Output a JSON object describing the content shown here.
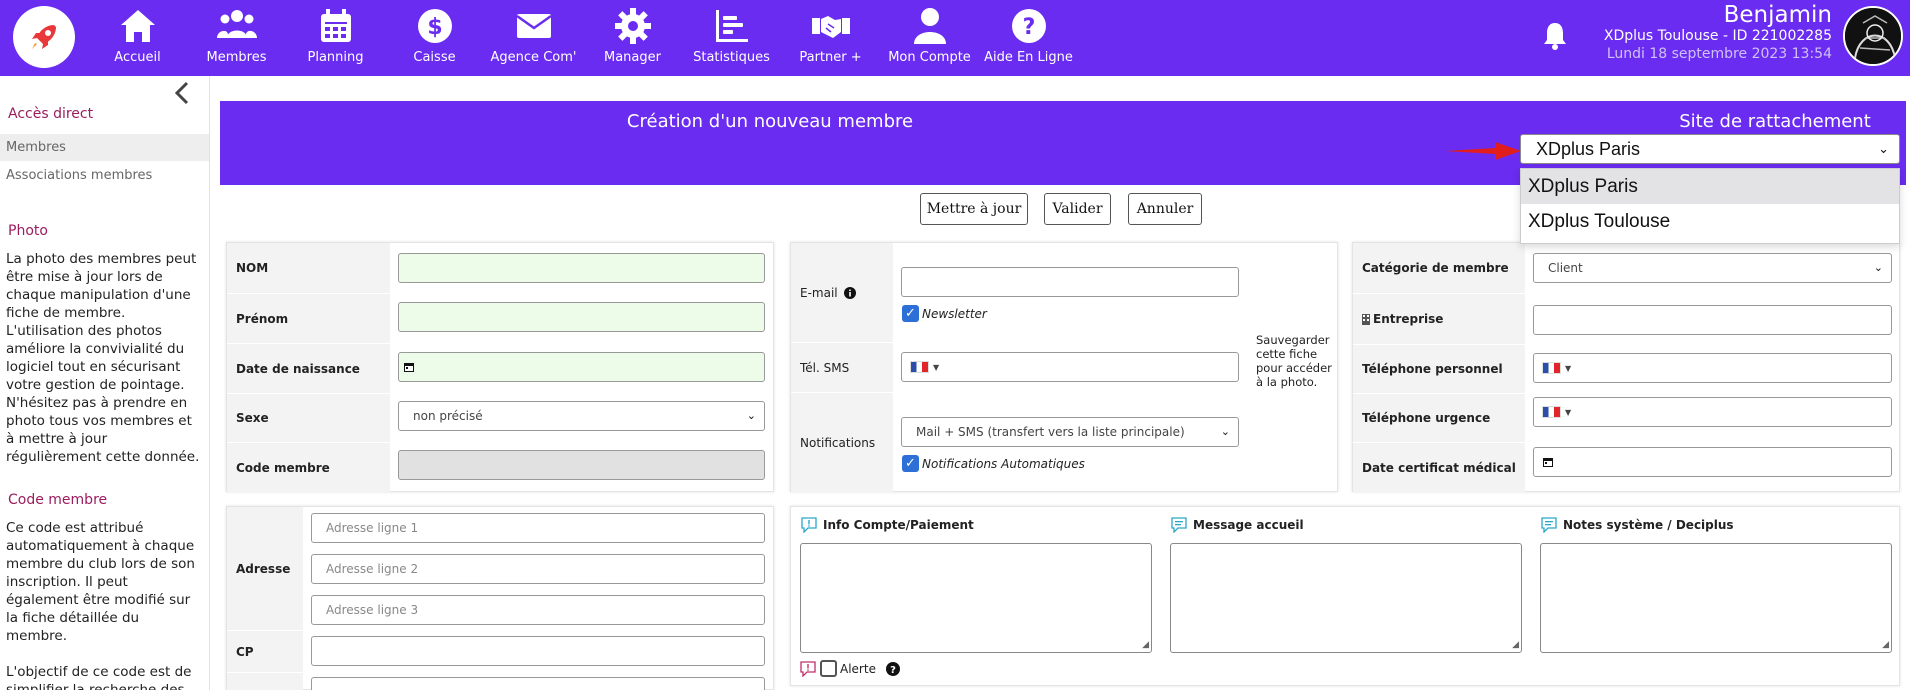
{
  "nav": {
    "items": [
      {
        "label": "Accueil",
        "icon": "home-icon"
      },
      {
        "label": "Membres",
        "icon": "users-icon"
      },
      {
        "label": "Planning",
        "icon": "calendar-icon"
      },
      {
        "label": "Caisse",
        "icon": "dollar-icon"
      },
      {
        "label": "Agence Com'",
        "icon": "mail-icon"
      },
      {
        "label": "Manager",
        "icon": "gear-icon"
      },
      {
        "label": "Statistiques",
        "icon": "chart-icon"
      },
      {
        "label": "Partner +",
        "icon": "handshake-icon"
      },
      {
        "label": "Mon Compte",
        "icon": "user-icon"
      },
      {
        "label": "Aide En Ligne",
        "icon": "help-icon"
      }
    ],
    "accent": "#6a2cf0"
  },
  "user": {
    "name": "Benjamin",
    "site": "XDplus Toulouse - ID 221002285",
    "date": "Lundi 18 septembre 2023 13:54"
  },
  "sidebar": {
    "section_title": "Accès direct",
    "links": [
      "Membres",
      "Associations membres"
    ],
    "photo_title": "Photo",
    "photo_text": "La photo des membres peut être mise à jour lors de chaque manipulation d'une fiche de membre. L'utilisation des photos améliore la convivialité du logiciel tout en sécurisant votre gestion de pointage. N'hésitez pas à prendre en photo tous vos membres et à mettre à jour régulièrement cette donnée.",
    "code_title": "Code membre",
    "code_text": "Ce code est attribué automatiquement à chaque membre du club lors de son inscription. Il peut également être modifié sur la fiche détaillée du membre.",
    "code_text2": "L'objectif de ce code est de simplifier la recherche des"
  },
  "header": {
    "title": "Création d'un nouveau membre",
    "site_title": "Site de rattachement",
    "site_selected": "XDplus Paris",
    "site_options": [
      "XDplus Paris",
      "XDplus Toulouse"
    ]
  },
  "actions": {
    "update": "Mettre à jour",
    "validate": "Valider",
    "cancel": "Annuler"
  },
  "identity": {
    "nom_label": "NOM",
    "prenom_label": "Prénom",
    "birth_label": "Date de naissance",
    "sexe_label": "Sexe",
    "sexe_value": "non précisé",
    "code_label": "Code membre"
  },
  "contact": {
    "email_label": "E-mail",
    "newsletter_label": "Newsletter",
    "sms_label": "Tél. SMS",
    "save_note": "Sauvegarder cette fiche pour accéder à la photo.",
    "notif_label": "Notifications",
    "notif_value": "Mail + SMS (transfert vers la liste principale)",
    "auto_notif_label": "Notifications Automatiques"
  },
  "category": {
    "cat_label": "Catégorie de membre",
    "cat_value": "Client",
    "company_label": "Entreprise",
    "phone_label": "Téléphone personnel",
    "urgent_label": "Téléphone urgence",
    "cert_label": "Date certificat médical"
  },
  "address": {
    "adresse_label": "Adresse",
    "line1_placeholder": "Adresse ligne 1",
    "line2_placeholder": "Adresse ligne 2",
    "line3_placeholder": "Adresse ligne 3",
    "cp_label": "CP"
  },
  "notes": {
    "info_title": "Info Compte/Paiement",
    "welcome_title": "Message accueil",
    "system_title": "Notes système / Deciplus",
    "alert_label": "Alerte"
  }
}
